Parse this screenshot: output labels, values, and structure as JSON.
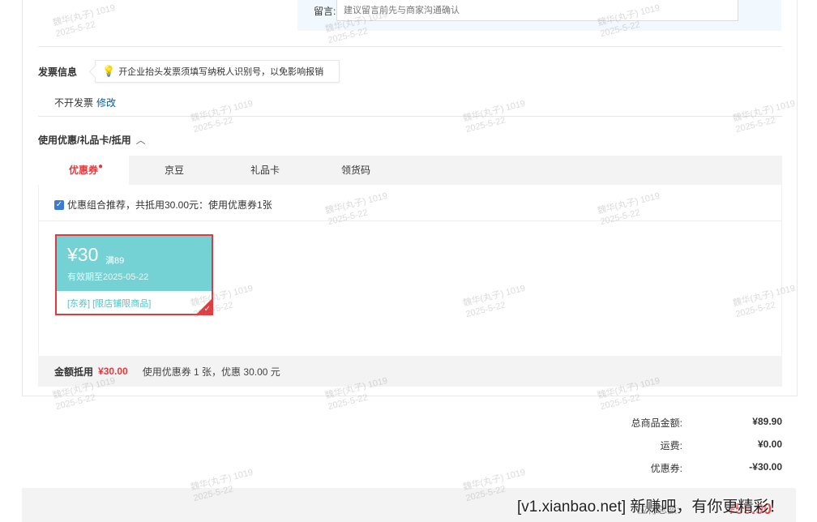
{
  "message": {
    "label": "留言:",
    "placeholder": "建议留言前先与商家沟通确认"
  },
  "invoice": {
    "title": "发票信息",
    "tip": "开企业抬头发票须填写纳税人识别号，以免影响报销",
    "status": "不开发票",
    "edit_label": "修改"
  },
  "coupons": {
    "title": "使用优惠/礼品卡/抵用",
    "tabs": [
      {
        "label": "优惠券",
        "marker": "●"
      },
      {
        "label": "京豆"
      },
      {
        "label": "礼品卡"
      },
      {
        "label": "领货码"
      }
    ],
    "combo_text": "优惠组合推荐，共抵用30.00元：使用优惠券1张",
    "card": {
      "amount": "¥30",
      "condition": "满89",
      "valid": "有效期至2025-05-22",
      "tags": "[东券] [限店铺限商品]"
    },
    "summary": {
      "label": "金额抵用",
      "amount": "¥30.00",
      "desc": "使用优惠券 1 张，优惠 30.00 元"
    }
  },
  "totals": [
    {
      "label": "总商品金额:",
      "value": "¥89.90"
    },
    {
      "label": "运费:",
      "value": "¥0.00"
    },
    {
      "label": "优惠券:",
      "value": "-¥30.00"
    }
  ],
  "pay": {
    "label": "应付总额:",
    "amount": "¥59.90"
  },
  "watermark": {
    "text": "魏华(丸子) 1019\n2025-5-22",
    "banner": "[v1.xianbao.net] 新赚吧，有你更精彩！"
  },
  "colors": {
    "accent": "#e4393c",
    "coupon": "#74d2d4",
    "link": "#005ea7"
  }
}
